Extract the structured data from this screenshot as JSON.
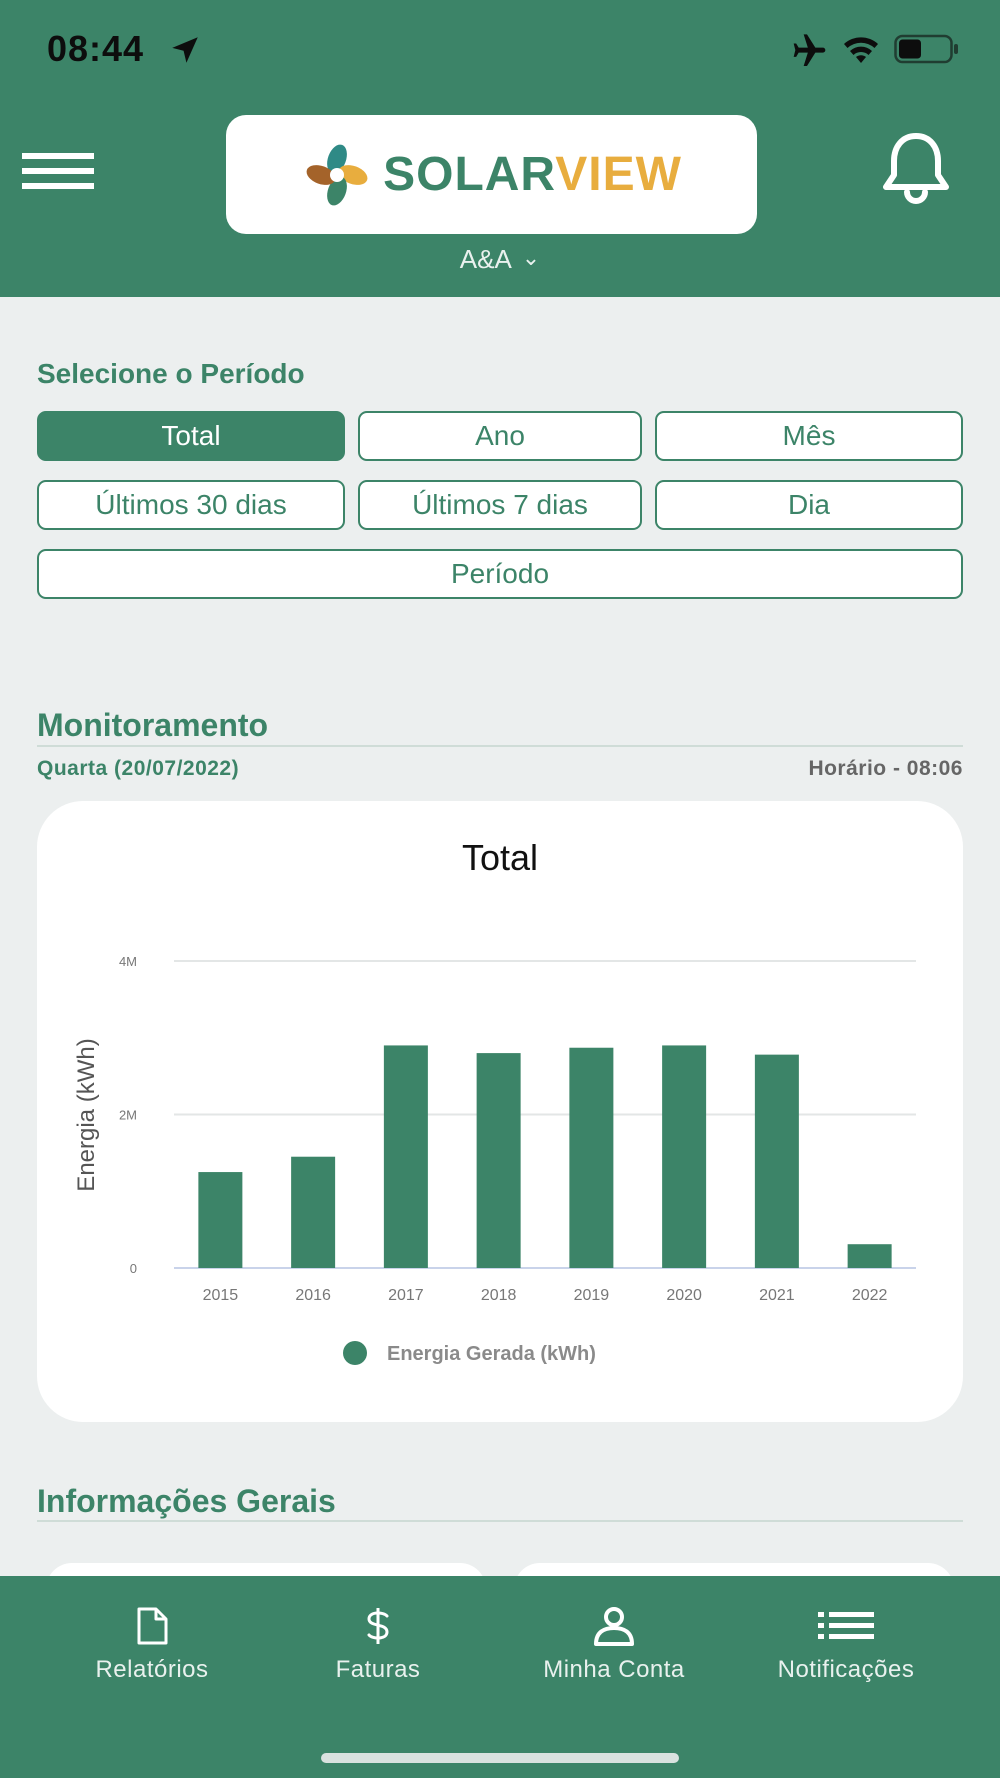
{
  "status_bar": {
    "time": "08:44"
  },
  "header": {
    "logo_solar": "SOLAR",
    "logo_view": "VIEW",
    "account": "A&A"
  },
  "period": {
    "title": "Selecione o Período",
    "buttons": [
      "Total",
      "Ano",
      "Mês",
      "Últimos 30 dias",
      "Últimos 7 dias",
      "Dia",
      "Período"
    ],
    "selected": "Total"
  },
  "monitor": {
    "title": "Monitoramento",
    "date": "Quarta (20/07/2022)",
    "time": "Horário - 08:06"
  },
  "chart_data": {
    "type": "bar",
    "title": "Total",
    "xlabel": "",
    "ylabel": "Energia (kWh)",
    "categories": [
      "2015",
      "2016",
      "2017",
      "2018",
      "2019",
      "2020",
      "2021",
      "2022"
    ],
    "series": [
      {
        "name": "Energia Gerada (kWh)",
        "values": [
          1250000,
          1450000,
          2900000,
          2800000,
          2870000,
          2900000,
          2780000,
          310000
        ]
      }
    ],
    "ylim": [
      0,
      4000000
    ],
    "yticks": [
      "0",
      "2M",
      "4M"
    ],
    "grid": true,
    "legend": "bottom",
    "color": "#3c8468"
  },
  "info": {
    "title": "Informações Gerais"
  },
  "nav": {
    "items": [
      "Relatórios",
      "Faturas",
      "Minha Conta",
      "Notificações"
    ]
  },
  "colors": {
    "brand": "#3c8468",
    "accent": "#e8ad3e",
    "background": "#ecefef"
  }
}
